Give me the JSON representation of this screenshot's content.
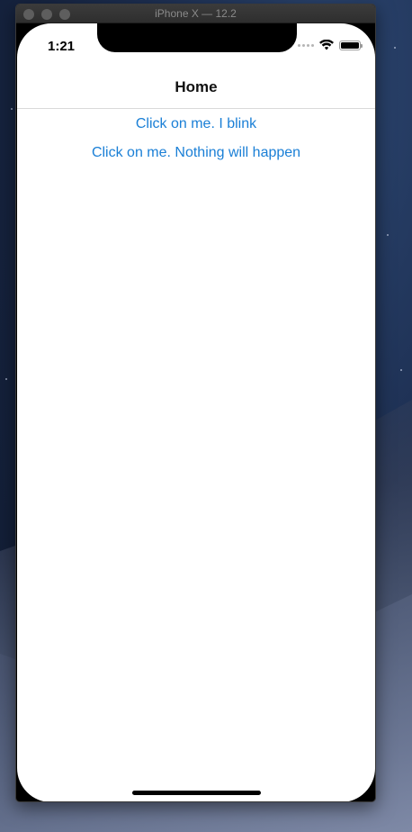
{
  "window": {
    "title": "iPhone X — 12.2"
  },
  "status_bar": {
    "time": "1:21"
  },
  "nav": {
    "title": "Home"
  },
  "buttons": [
    {
      "label": "Click on me. I blink"
    },
    {
      "label": "Click on me. Nothing will happen"
    }
  ],
  "colors": {
    "link": "#1a7fd6",
    "background": "#ffffff"
  },
  "icons": [
    "wifi-icon",
    "battery-icon",
    "signal-icon"
  ]
}
